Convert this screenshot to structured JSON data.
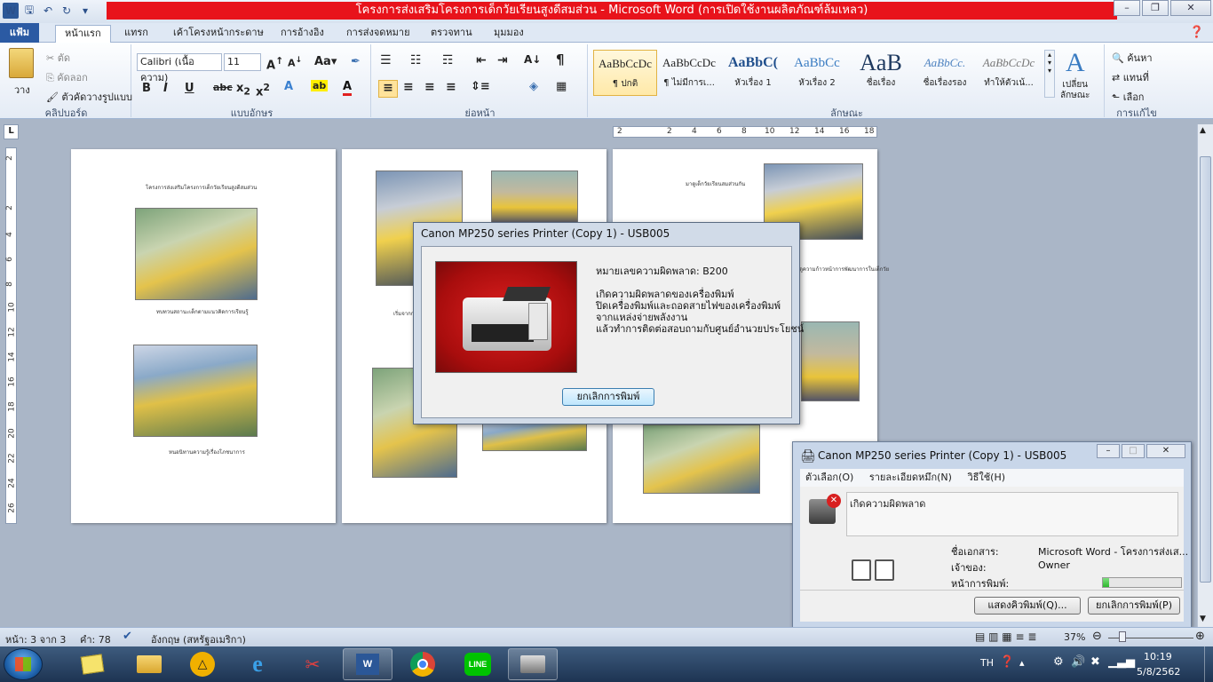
{
  "app": {
    "title": "โครงการส่งเสริมโครงการเด็กวัยเรียนสูงดีสมส่วน  -  Microsoft Word (การเปิดใช้งานผลิตภัณฑ์ล้มเหลว)"
  },
  "tabs": [
    "แฟ้ม",
    "หน้าแรก",
    "แทรก",
    "เค้าโครงหน้ากระดาษ",
    "การอ้างอิง",
    "การส่งจดหมาย",
    "ตรวจทาน",
    "มุมมอง"
  ],
  "clipboard": {
    "paste": "วาง",
    "cut": "ตัด",
    "copy": "คัดลอก",
    "format_painter": "ตัวคัดวางรูปแบบ",
    "label": "คลิปบอร์ด"
  },
  "font": {
    "name": "Calibri (เนื้อความ)",
    "size": "11",
    "label": "แบบอักษร"
  },
  "paragraph": {
    "label": "ย่อหน้า"
  },
  "styles": {
    "label": "ลักษณะ",
    "items": [
      {
        "sample": "AaBbCcDc",
        "name": "¶ ปกติ"
      },
      {
        "sample": "AaBbCcDc",
        "name": "¶ ไม่มีการเ..."
      },
      {
        "sample": "AaBbC(",
        "name": "หัวเรื่อง 1"
      },
      {
        "sample": "AaBbCc",
        "name": "หัวเรื่อง 2"
      },
      {
        "sample": "AaB",
        "name": "ชื่อเรื่อง"
      },
      {
        "sample": "AaBbCc.",
        "name": "ชื่อเรื่องรอง"
      },
      {
        "sample": "AaBbCcDc",
        "name": "ทำให้ตัวเน้..."
      }
    ],
    "change": "เปลี่ยน\nลักษณะ"
  },
  "editing": {
    "find": "ค้นหา",
    "replace": "แทนที่",
    "select": "เลือก",
    "label": "การแก้ไข"
  },
  "ruler": {
    "h_ticks": [
      "2",
      "2",
      "4",
      "6",
      "8",
      "10",
      "12",
      "14",
      "16",
      "18"
    ],
    "v_ticks": [
      "2",
      "2",
      "4",
      "6",
      "8",
      "10",
      "12",
      "14",
      "16",
      "18",
      "20",
      "22",
      "24",
      "26"
    ]
  },
  "pages": {
    "p1_title": "โครงการส่งเสริมโครงการเด็กวัยเรียนสูงดีสมส่วน",
    "p1_caption1": "ทบทวนสถานะเด็กตามแนวคิดการเรียนรู้",
    "p1_caption2": "หนอนิทานความรู้เรื่องโภชนาการ",
    "p2_caption": "เริ่มจากการ",
    "p3_title": "มาดูเด็กวัยเรียนสมส่วนกัน",
    "p3_caption": "ดูความก้าวหน้าการพัฒนาการในเด็กวัย"
  },
  "error_dialog": {
    "title": "Canon MP250 series Printer (Copy 1) - USB005",
    "error_number": "หมายเลขความผิดพลาด: B200",
    "lines": [
      "เกิดความผิดพลาดของเครื่องพิมพ์",
      "ปิดเครื่องพิมพ์และถอดสายไฟของเครื่องพิมพ์",
      "จากแหล่งจ่ายพลังงาน",
      "แล้วทำการติดต่อสอบถามกับศูนย์อำนวยประโยชน์"
    ],
    "cancel_button": "ยกเลิกการพิมพ์"
  },
  "print_queue": {
    "title": "Canon MP250 series Printer (Copy 1) - USB005",
    "menu": [
      "ตัวเลือก(O)",
      "รายละเอียดหมึก(N)",
      "วิธีใช้(H)"
    ],
    "message": "เกิดความผิดพลาด",
    "doc_label": "ชื่อเอกสาร:",
    "doc_value": "Microsoft Word - โครงการส่งเส...",
    "owner_label": "เจ้าของ:",
    "owner_value": "Owner",
    "pages_label": "หน้าการพิมพ์:",
    "progress": 0.08,
    "show_button": "แสดงคิวพิมพ์(Q)...",
    "cancel_button": "ยกเลิกการพิมพ์(P)"
  },
  "status": {
    "page": "หน้า: 3 จาก 3",
    "words": "คำ: 78",
    "language": "อังกฤษ (สหรัฐอเมริกา)",
    "zoom": "37%"
  },
  "tray": {
    "lang": "TH",
    "time": "10:19",
    "date": "5/8/2562"
  },
  "colors": {
    "title_red": "#e8131b",
    "file_tab": "#2b5aa3"
  }
}
